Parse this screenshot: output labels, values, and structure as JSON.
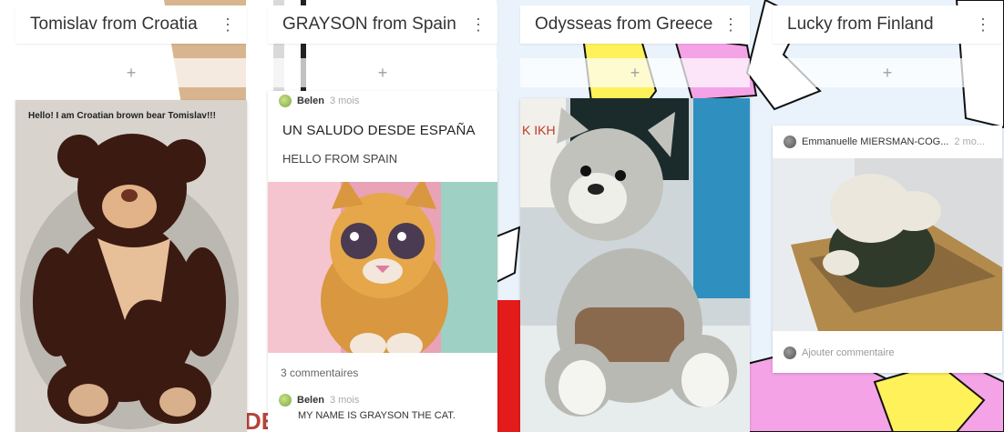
{
  "columns": [
    {
      "title": "Tomislav from Croatia"
    },
    {
      "title": "GRAYSON from Spain"
    },
    {
      "title": "Odysseas from Greece"
    },
    {
      "title": "Lucky from Finland"
    }
  ],
  "icons": {
    "menu": "⋮",
    "add": "+"
  },
  "croatia": {
    "photo_caption": "Hello! I am Croatian brown bear Tomislav!!!"
  },
  "spain": {
    "author": "Belen",
    "time": "3 mois",
    "title": "UN SALUDO DESDE ESPAÑA",
    "body": "HELLO FROM SPAIN",
    "comments_count": "3 commentaires",
    "comment": {
      "author": "Belen",
      "time": "3 mois",
      "text": "MY NAME IS GRAYSON THE CAT."
    }
  },
  "greece": {
    "wall_letters": "Κ ΙΚΗ ΝΙΑ"
  },
  "finland": {
    "author": "Emmanuelle MIERSMAN-COG...",
    "time": "2 mo...",
    "add_comment": "Ajouter commentaire"
  },
  "bg_letters": "DE",
  "colors": {
    "map_water": "#e9f2fb",
    "map_yellow": "#fff15a",
    "map_pink": "#f4a3e6",
    "map_red": "#e31b1b",
    "bear_brown": "#3b1a12",
    "scarf": "#e7c09a"
  }
}
